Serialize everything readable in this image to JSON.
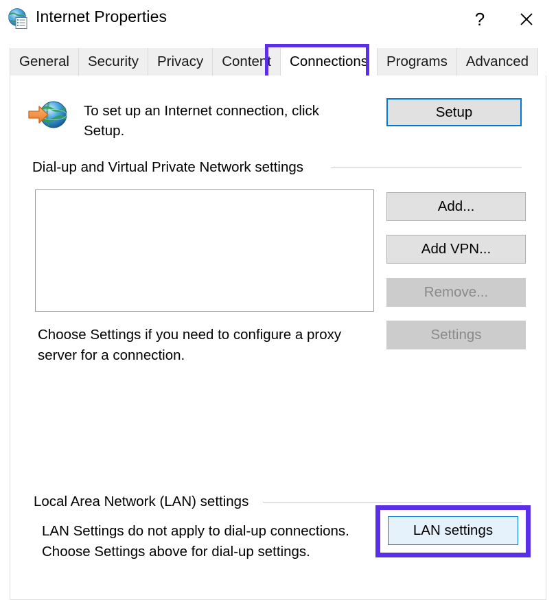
{
  "window": {
    "title": "Internet Properties",
    "icon": "internet-properties-icon",
    "help_label": "?",
    "close_label": "✕"
  },
  "tabs": [
    {
      "label": "General",
      "selected": false
    },
    {
      "label": "Security",
      "selected": false
    },
    {
      "label": "Privacy",
      "selected": false
    },
    {
      "label": "Content",
      "selected": false
    },
    {
      "label": "Connections",
      "selected": true
    },
    {
      "label": "Programs",
      "selected": false
    },
    {
      "label": "Advanced",
      "selected": false
    }
  ],
  "setup": {
    "icon": "globe-with-arrow-icon",
    "description": "To set up an Internet connection, click Setup.",
    "button_label": "Setup"
  },
  "dialup": {
    "group_label": "Dial-up and Virtual Private Network settings",
    "entries": [],
    "buttons": {
      "add": "Add...",
      "add_vpn": "Add VPN...",
      "remove": "Remove...",
      "settings": "Settings"
    },
    "proxy_hint": "Choose Settings if you need to configure a proxy server for a connection."
  },
  "lan": {
    "group_label": "Local Area Network (LAN) settings",
    "description": "LAN Settings do not apply to dial-up connections. Choose Settings above for dial-up settings.",
    "button_label": "LAN settings"
  },
  "colors": {
    "highlight": "#5b2ee8",
    "focus_border": "#0078d7",
    "hover_fill": "#e5f1fb",
    "button_fill": "#e1e1e1",
    "disabled_fill": "#cccccc",
    "tab_fill": "#efefef"
  }
}
